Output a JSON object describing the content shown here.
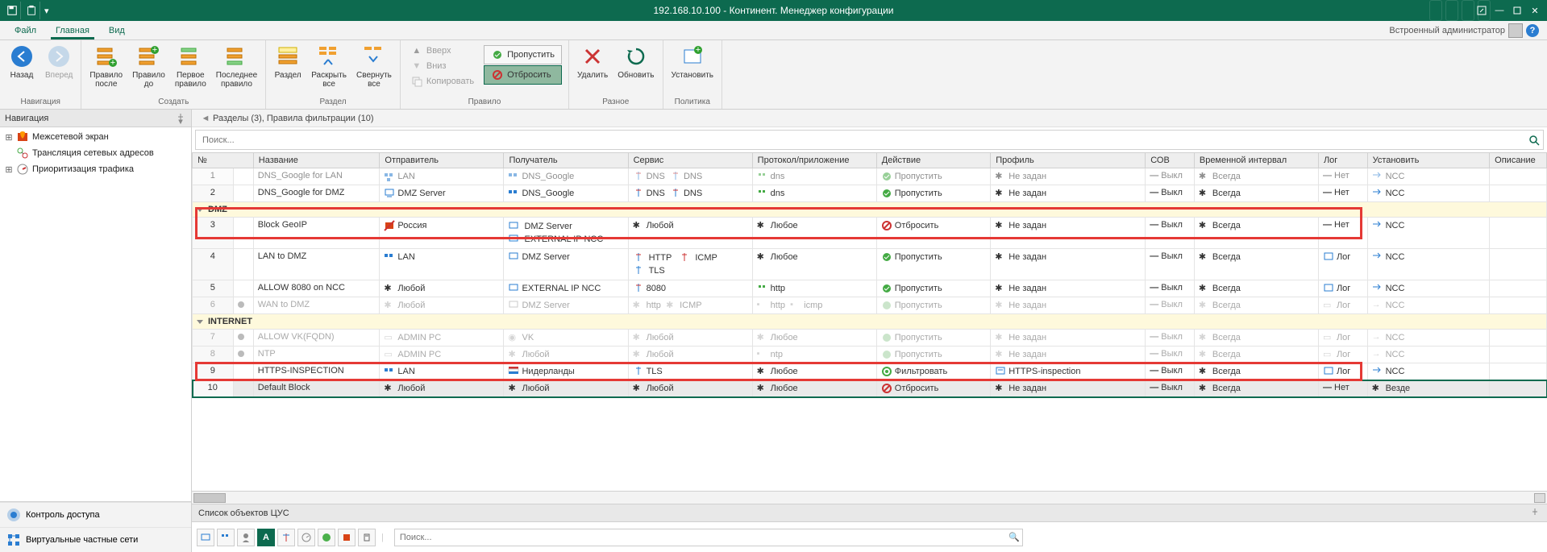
{
  "titlebar": {
    "title": "192.168.10.100 - Континент. Менеджер конфигурации"
  },
  "tabs": {
    "file": "Файл",
    "main": "Главная",
    "view": "Вид",
    "user": "Встроенный администратор"
  },
  "ribbon": {
    "nav": {
      "back": "Назад",
      "fwd": "Вперед",
      "group": "Навигация"
    },
    "create": {
      "after": "Правило\nпосле",
      "before": "Правило\nдо",
      "first": "Первое\nправило",
      "last": "Последнее\nправило",
      "group": "Создать"
    },
    "section": {
      "section": "Раздел",
      "expand": "Раскрыть\nвсе",
      "collapse": "Свернуть\nвсе",
      "group": "Раздел"
    },
    "rule": {
      "up": "Вверх",
      "down": "Вниз",
      "copy": "Копировать",
      "skip": "Пропустить",
      "drop": "Отбросить",
      "group": "Правило"
    },
    "misc": {
      "delete": "Удалить",
      "refresh": "Обновить",
      "group": "Разное"
    },
    "policy": {
      "install": "Установить",
      "group": "Политика"
    }
  },
  "nav": {
    "header": "Навигация",
    "items": [
      "Межсетевой экран",
      "Трансляция сетевых адресов",
      "Приоритизация трафика"
    ],
    "bottom": [
      "Контроль доступа",
      "Виртуальные частные сети"
    ]
  },
  "breadcrumb": "Разделы (3), Правила фильтрации (10)",
  "search_placeholder": "Поиск...",
  "columns": {
    "num": "№",
    "name": "Название",
    "sender": "Отправитель",
    "receiver": "Получатель",
    "service": "Сервис",
    "proto": "Протокол/приложение",
    "action": "Действие",
    "profile": "Профиль",
    "cob": "СОВ",
    "time": "Временной интервал",
    "log": "Лог",
    "install": "Установить",
    "desc": "Описание"
  },
  "labels": {
    "any": "Любой",
    "anyn": "Любое",
    "notset": "Не задан",
    "off": "Выкл",
    "always": "Всегда",
    "net": "Нет",
    "log": "Лог",
    "ncc": "NCC",
    "everywhere": "Везде",
    "allow": "Пропустить",
    "drop": "Отбросить",
    "filter": "Фильтровать"
  },
  "groups": {
    "dmz": "DMZ",
    "internet": "INTERNET"
  },
  "rows": {
    "r1": {
      "num": "1",
      "name": "DNS_Google for LAN",
      "send": "LAN",
      "recv": "DNS_Google",
      "srv1": "DNS",
      "srv2": "DNS",
      "proto": "dns"
    },
    "r2": {
      "num": "2",
      "name": "DNS_Google for DMZ",
      "send": "DMZ Server",
      "recv": "DNS_Google",
      "srv1": "DNS",
      "srv2": "DNS",
      "proto": "dns"
    },
    "r3": {
      "num": "3",
      "name": "Block GeoIP",
      "send": "Россия",
      "recv1": "DMZ Server",
      "recv2": "EXTERNAL IP NCC"
    },
    "r4": {
      "num": "4",
      "name": "LAN to DMZ",
      "send": "LAN",
      "recv": "DMZ Server",
      "srv1": "HTTP",
      "srv2": "ICMP",
      "srv3": "TLS"
    },
    "r5": {
      "num": "5",
      "name": "ALLOW 8080 on NCC",
      "recv": "EXTERNAL IP NCC",
      "srv": "8080",
      "proto": "http"
    },
    "r6": {
      "num": "6",
      "name": "WAN to DMZ",
      "recv": "DMZ Server",
      "srv1": "http",
      "srv2": "ICMP",
      "proto1": "http",
      "proto2": "icmp"
    },
    "r7": {
      "num": "7",
      "name": "ALLOW VK(FQDN)",
      "send": "ADMIN PC",
      "recv": "VK"
    },
    "r8": {
      "num": "8",
      "name": "NTP",
      "send": "ADMIN PC",
      "proto": "ntp"
    },
    "r9": {
      "num": "9",
      "name": "HTTPS-INSPECTION",
      "send": "LAN",
      "recv": "Нидерланды",
      "srv": "TLS",
      "profile": "HTTPS-inspection"
    },
    "r10": {
      "num": "10",
      "name": "Default Block"
    }
  },
  "objlist": {
    "header": "Список объектов ЦУС",
    "search": "Поиск..."
  }
}
